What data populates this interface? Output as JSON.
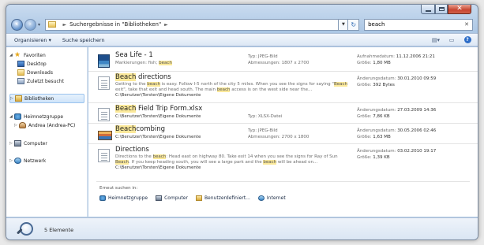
{
  "address": {
    "crumbs": [
      "Suchergebnisse in \"Bibliotheken\""
    ],
    "search_value": "beach"
  },
  "toolbar": {
    "organize": "Organisieren ▾",
    "save_search": "Suche speichern"
  },
  "nav": {
    "favorites": "Favoriten",
    "desktop": "Desktop",
    "downloads": "Downloads",
    "recent": "Zuletzt besucht",
    "libraries": "Bibliotheken",
    "homegroup": "Heimnetzgruppe",
    "homegroup_user": "Andrea (Andrea-PC)",
    "computer": "Computer",
    "network": "Netzwerk"
  },
  "results": [
    {
      "name_pre": "Sea Life - 1",
      "name_hl": "",
      "name_post": "",
      "sub1_pre": "Markierungen: fish; ",
      "sub1_hl": "beach",
      "sub1_post": "",
      "type": "Typ: JPEG-Bild",
      "dims": "Abmessungen: 1807 x 2700",
      "date_label": "Aufnahmedatum: ",
      "date": "11.12.2006 21:21",
      "size_label": "Größe: ",
      "size": "1,80 MB"
    },
    {
      "name_pre": "",
      "name_hl": "Beach",
      "name_post": " directions",
      "line1_a": "Getting to the ",
      "line1_hl1": "beach",
      "line1_b": " is easy. Follow I-5 north of the city 5 miles. When you see the signs for saying \"",
      "line1_hl2": "Beach",
      "line1_c": "",
      "line2_a": "exit\", take that exit and head south. The main ",
      "line2_hl": "beach",
      "line2_b": " access is on the west side near the...",
      "path": "C:\\Benutzer\\Torsten\\Eigene Dokumente",
      "date_label": "Änderungsdatum: ",
      "date": "30.01.2010 09:59",
      "size_label": "Größe: ",
      "size": "392 Bytes"
    },
    {
      "name_pre": "",
      "name_hl": "Beach",
      "name_post": " Field Trip Form.xlsx",
      "path": "C:\\Benutzer\\Torsten\\Eigene Dokumente",
      "type": "Typ: XLSX-Datei",
      "date_label": "Änderungsdatum: ",
      "date": "27.03.2009 14:36",
      "size_label": "Größe: ",
      "size": "7,86 KB"
    },
    {
      "name_pre": "",
      "name_hl": "Beach",
      "name_post": "combing",
      "path": "C:\\Benutzer\\Torsten\\Eigene Dokumente",
      "type": "Typ: JPEG-Bild",
      "dims": "Abmessungen: 2700 x 1800",
      "date_label": "Änderungsdatum: ",
      "date": "30.05.2006 02:46",
      "size_label": "Größe: ",
      "size": "1,63 MB"
    },
    {
      "name_pre": "Directions",
      "name_hl": "",
      "name_post": "",
      "line1_a": "Directions to the ",
      "line1_hl1": "beach",
      "line1_b": ": Head east on highway 80. Take exit 14 when you see the signs for Ray of Sun",
      "line2_a": "",
      "line2_hl": "Beach",
      "line2_b": ". If you keep heading south, you will see a large park and the ",
      "line2_hl2": "beach",
      "line2_c": " will be ahead on...",
      "path": "C:\\Benutzer\\Torsten\\Eigene Dokumente",
      "date_label": "Änderungsdatum: ",
      "date": "03.02.2010 19:17",
      "size_label": "Größe: ",
      "size": "1,39 KB"
    }
  ],
  "search_again": {
    "label": "Erneut suchen in:",
    "homegroup": "Heimnetzgruppe",
    "computer": "Computer",
    "custom": "Benutzerdefiniert...",
    "internet": "Internet"
  },
  "details": {
    "count": "5 Elemente"
  },
  "icons": [
    "back-arrow-icon",
    "forward-arrow-icon",
    "search-icon",
    "star-icon",
    "folder-icon",
    "computer-icon",
    "network-icon",
    "magnifier-icon"
  ]
}
